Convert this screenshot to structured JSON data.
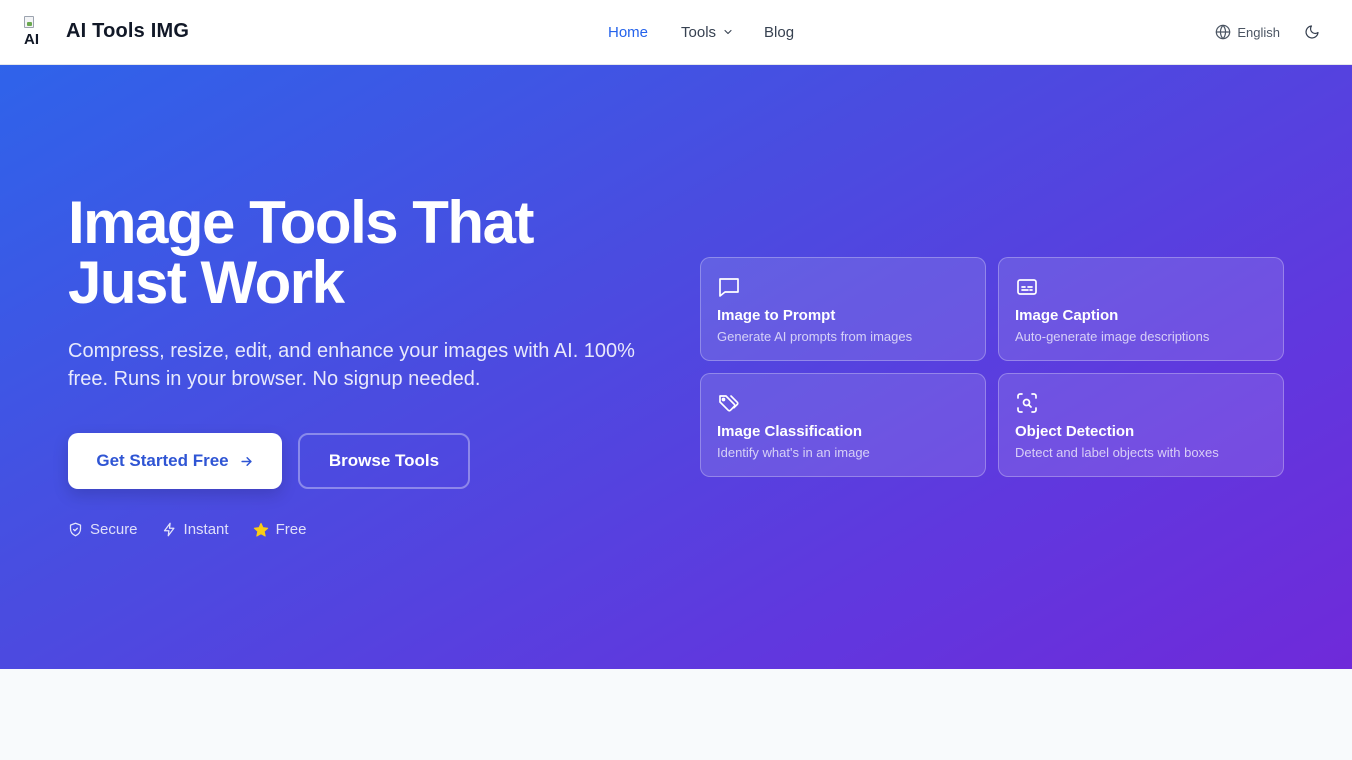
{
  "header": {
    "logo_alt": "AI",
    "brand": "AI Tools IMG",
    "nav": {
      "home": "Home",
      "tools": "Tools",
      "blog": "Blog"
    },
    "language": "English"
  },
  "hero": {
    "title_line1": "Image Tools That",
    "title_line2": "Just Work",
    "subtitle": "Compress, resize, edit, and enhance your images with AI. 100% free. Runs in your browser. No signup needed.",
    "primary_button": "Get Started Free",
    "secondary_button": "Browse Tools",
    "features": [
      "Secure",
      "Instant",
      "Free"
    ]
  },
  "tool_cards": [
    {
      "title": "Image to Prompt",
      "description": "Generate AI prompts from images",
      "icon": "message-square-icon"
    },
    {
      "title": "Image Caption",
      "description": "Auto-generate image descriptions",
      "icon": "captions-icon"
    },
    {
      "title": "Image Classification",
      "description": "Identify what's in an image",
      "icon": "tags-icon"
    },
    {
      "title": "Object Detection",
      "description": "Detect and label objects with boxes",
      "icon": "scan-search-icon"
    }
  ],
  "colors": {
    "accent": "#2563eb",
    "hero_gradient_start": "#2f63ea",
    "hero_gradient_end": "#6f2ad9",
    "star": "#facc15"
  }
}
